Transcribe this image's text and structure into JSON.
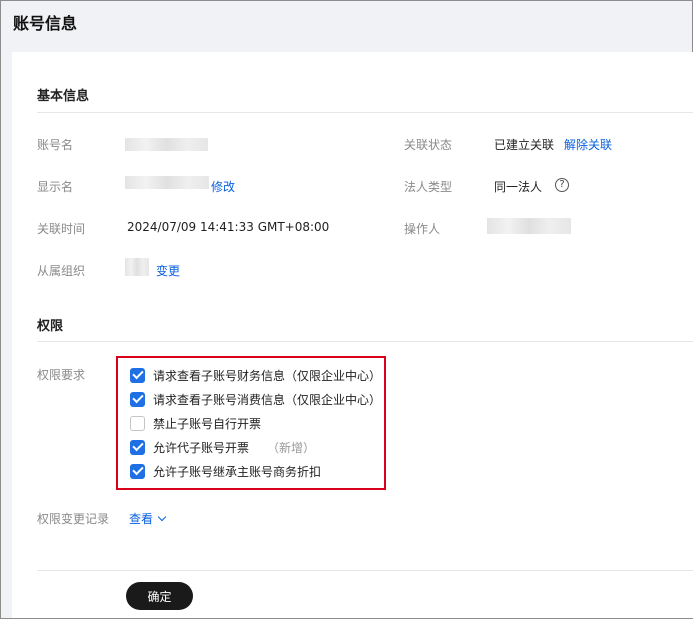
{
  "page": {
    "title": "账号信息"
  },
  "basic": {
    "section_title": "基本信息",
    "account_name_label": "账号名",
    "display_name_label": "显示名",
    "display_name_edit": "修改",
    "link_time_label": "关联时间",
    "link_time_value": "2024/07/09 14:41:33 GMT+08:00",
    "org_label": "从属组织",
    "org_change": "变更",
    "link_status_label": "关联状态",
    "link_status_value": "已建立关联",
    "unlink": "解除关联",
    "legal_type_label": "法人类型",
    "legal_type_value": "同一法人",
    "help_glyph": "?",
    "operator_label": "操作人"
  },
  "permissions": {
    "section_title": "权限",
    "requirements_label": "权限要求",
    "items": [
      {
        "label": "请求查看子账号财务信息（仅限企业中心）",
        "checked": true,
        "note": ""
      },
      {
        "label": "请求查看子账号消费信息（仅限企业中心）",
        "checked": true,
        "note": ""
      },
      {
        "label": "禁止子账号自行开票",
        "checked": false,
        "note": ""
      },
      {
        "label": "允许代子账号开票",
        "checked": true,
        "note": "（新增）"
      },
      {
        "label": "允许子账号继承主账号商务折扣",
        "checked": true,
        "note": ""
      }
    ],
    "history_label": "权限变更记录",
    "history_view": "查看"
  },
  "actions": {
    "confirm_label": "确定"
  },
  "colors": {
    "accent": "#1f6fe5",
    "link": "#0a60e0",
    "highlight_border": "#d9001b"
  }
}
